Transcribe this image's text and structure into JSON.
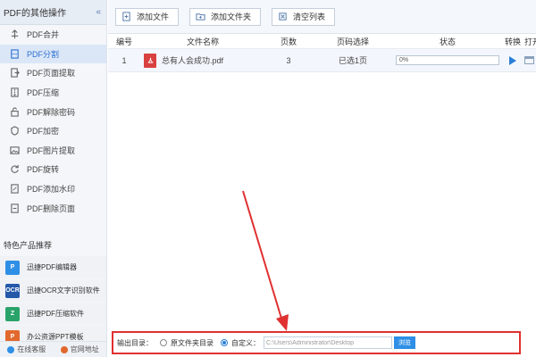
{
  "sidebar": {
    "header": "PDF的其他操作",
    "collapse_glyph": "«",
    "items": [
      {
        "label": "PDF合并",
        "icon": "merge-icon"
      },
      {
        "label": "PDF分割",
        "icon": "split-icon",
        "active": true
      },
      {
        "label": "PDF页面提取",
        "icon": "extract-page-icon"
      },
      {
        "label": "PDF压缩",
        "icon": "compress-icon"
      },
      {
        "label": "PDF解除密码",
        "icon": "unlock-icon"
      },
      {
        "label": "PDF加密",
        "icon": "lock-icon"
      },
      {
        "label": "PDF图片提取",
        "icon": "image-icon"
      },
      {
        "label": "PDF旋转",
        "icon": "rotate-icon"
      },
      {
        "label": "PDF添加水印",
        "icon": "watermark-icon"
      },
      {
        "label": "PDF删除页面",
        "icon": "delete-page-icon"
      }
    ],
    "recommend_title": "特色产品推荐",
    "recommend": [
      {
        "label": "迅捷PDF编辑器",
        "logo_text": "P"
      },
      {
        "label": "迅捷OCR文字识别软件",
        "logo_text": "OCR"
      },
      {
        "label": "迅捷PDF压缩软件",
        "logo_text": "Z"
      },
      {
        "label": "办公资源PPT模板",
        "logo_text": "P"
      }
    ],
    "footer": {
      "service": "在线客服",
      "website": "官网地址"
    }
  },
  "toolbar": {
    "add_file": "添加文件",
    "add_folder": "添加文件夹",
    "clear_list": "清空列表"
  },
  "table": {
    "headers": {
      "num": "编号",
      "name": "文件名称",
      "pages": "页数",
      "range": "页码选择",
      "status": "状态",
      "convert": "转换",
      "open": "打开"
    },
    "rows": [
      {
        "num": "1",
        "name": "总有人会成功.pdf",
        "pages": "3",
        "range": "已选1页",
        "progress": "0%"
      }
    ]
  },
  "output": {
    "label": "输出目录：",
    "option_source": "原文件夹目录",
    "option_custom": "自定义：",
    "path": "C:\\Users\\Administrator\\Desktop",
    "browse": "浏览"
  },
  "colors": {
    "accent": "#2b7fd6",
    "annotation": "#e03030",
    "pdf_red": "#d94040"
  }
}
